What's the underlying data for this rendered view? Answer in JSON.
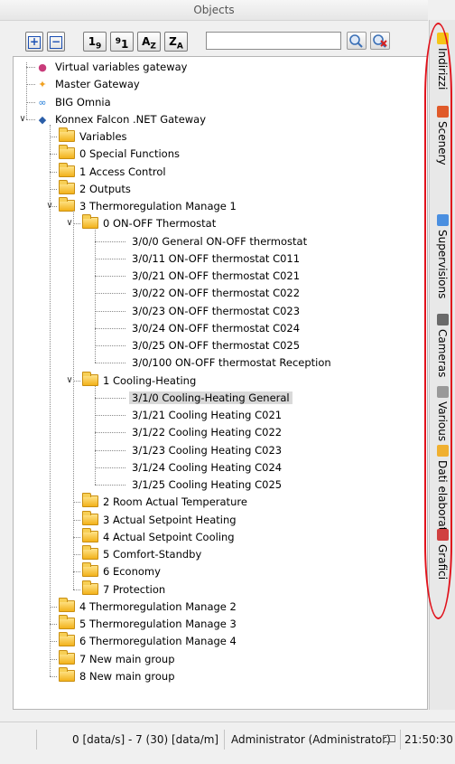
{
  "panel": {
    "title": "Objects"
  },
  "toolbar": {
    "expand_all": "+",
    "collapse_all": "−",
    "sort_19_main": "1",
    "sort_19_sub": "9",
    "sort_91_sup": "9",
    "sort_91_main": "1",
    "sort_az_main": "A",
    "sort_az_sub": "Z",
    "sort_za_main": "Z",
    "sort_za_sub": "A",
    "search_value": ""
  },
  "tree": {
    "gateways": [
      {
        "label": "Virtual variables gateway",
        "icon": "virtual-gateway-icon"
      },
      {
        "label": "Master Gateway",
        "icon": "master-gateway-icon"
      },
      {
        "label": "BIG Omnia",
        "icon": "big-omnia-icon"
      },
      {
        "label": "Konnex Falcon .NET Gateway",
        "icon": "knx-gateway-icon"
      }
    ],
    "knx_children": [
      "Variables",
      "0 Special Functions",
      "1 Access Control",
      "2 Outputs",
      "3 Thermoregulation Manage 1"
    ],
    "thermo1_children": [
      "0 ON-OFF Thermostat",
      "1 Cooling-Heating",
      "2 Room Actual Temperature",
      "3 Actual Setpoint Heating",
      "4 Actual Setpoint Cooling",
      "5 Comfort-Standby",
      "6 Economy",
      "7 Protection"
    ],
    "onoff_items": [
      "3/0/0 General ON-OFF thermostat",
      "3/0/11 ON-OFF thermostat C011",
      "3/0/21 ON-OFF thermostat C021",
      "3/0/22 ON-OFF thermostat C022",
      "3/0/23 ON-OFF thermostat C023",
      "3/0/24 ON-OFF thermostat C024",
      "3/0/25 ON-OFF thermostat C025",
      "3/0/100 ON-OFF thermostat Reception"
    ],
    "cooling_items": [
      "3/1/0 Cooling-Heating General",
      "3/1/21 Cooling Heating C021",
      "3/1/22 Cooling Heating C022",
      "3/1/23 Cooling Heating C023",
      "3/1/24 Cooling Heating C024",
      "3/1/25 Cooling Heating C025"
    ],
    "knx_tail": [
      "4 Thermoregulation Manage 2",
      "5 Thermoregulation Manage 3",
      "6 Thermoregulation Manage 4",
      "7 New main group",
      "8 New main group"
    ],
    "selected": "3/1/0 Cooling-Heating General"
  },
  "sidebar_tabs": [
    {
      "label": "Indirizzi",
      "icon": "bulb-icon",
      "color": "#f5c518"
    },
    {
      "label": "Scenery",
      "icon": "scenery-icon",
      "color": "#e05a2a"
    },
    {
      "label": "Supervisions",
      "icon": "supervision-icon",
      "color": "#4a8fe0"
    },
    {
      "label": "Cameras",
      "icon": "camera-icon",
      "color": "#6a6a6a"
    },
    {
      "label": "Various",
      "icon": "various-icon",
      "color": "#999999"
    },
    {
      "label": "Dati elaborati",
      "icon": "data-icon",
      "color": "#f0b030"
    },
    {
      "label": "Grafici",
      "icon": "charts-icon",
      "color": "#d04040"
    }
  ],
  "statusbar": {
    "rate": "0 [data/s] - 7 (30) [data/m]",
    "user": "Administrator (Administrator)",
    "time": "21:50:30"
  },
  "colors": {
    "highlight_circle": "#e1121b",
    "selection": "#d9d9d9"
  }
}
